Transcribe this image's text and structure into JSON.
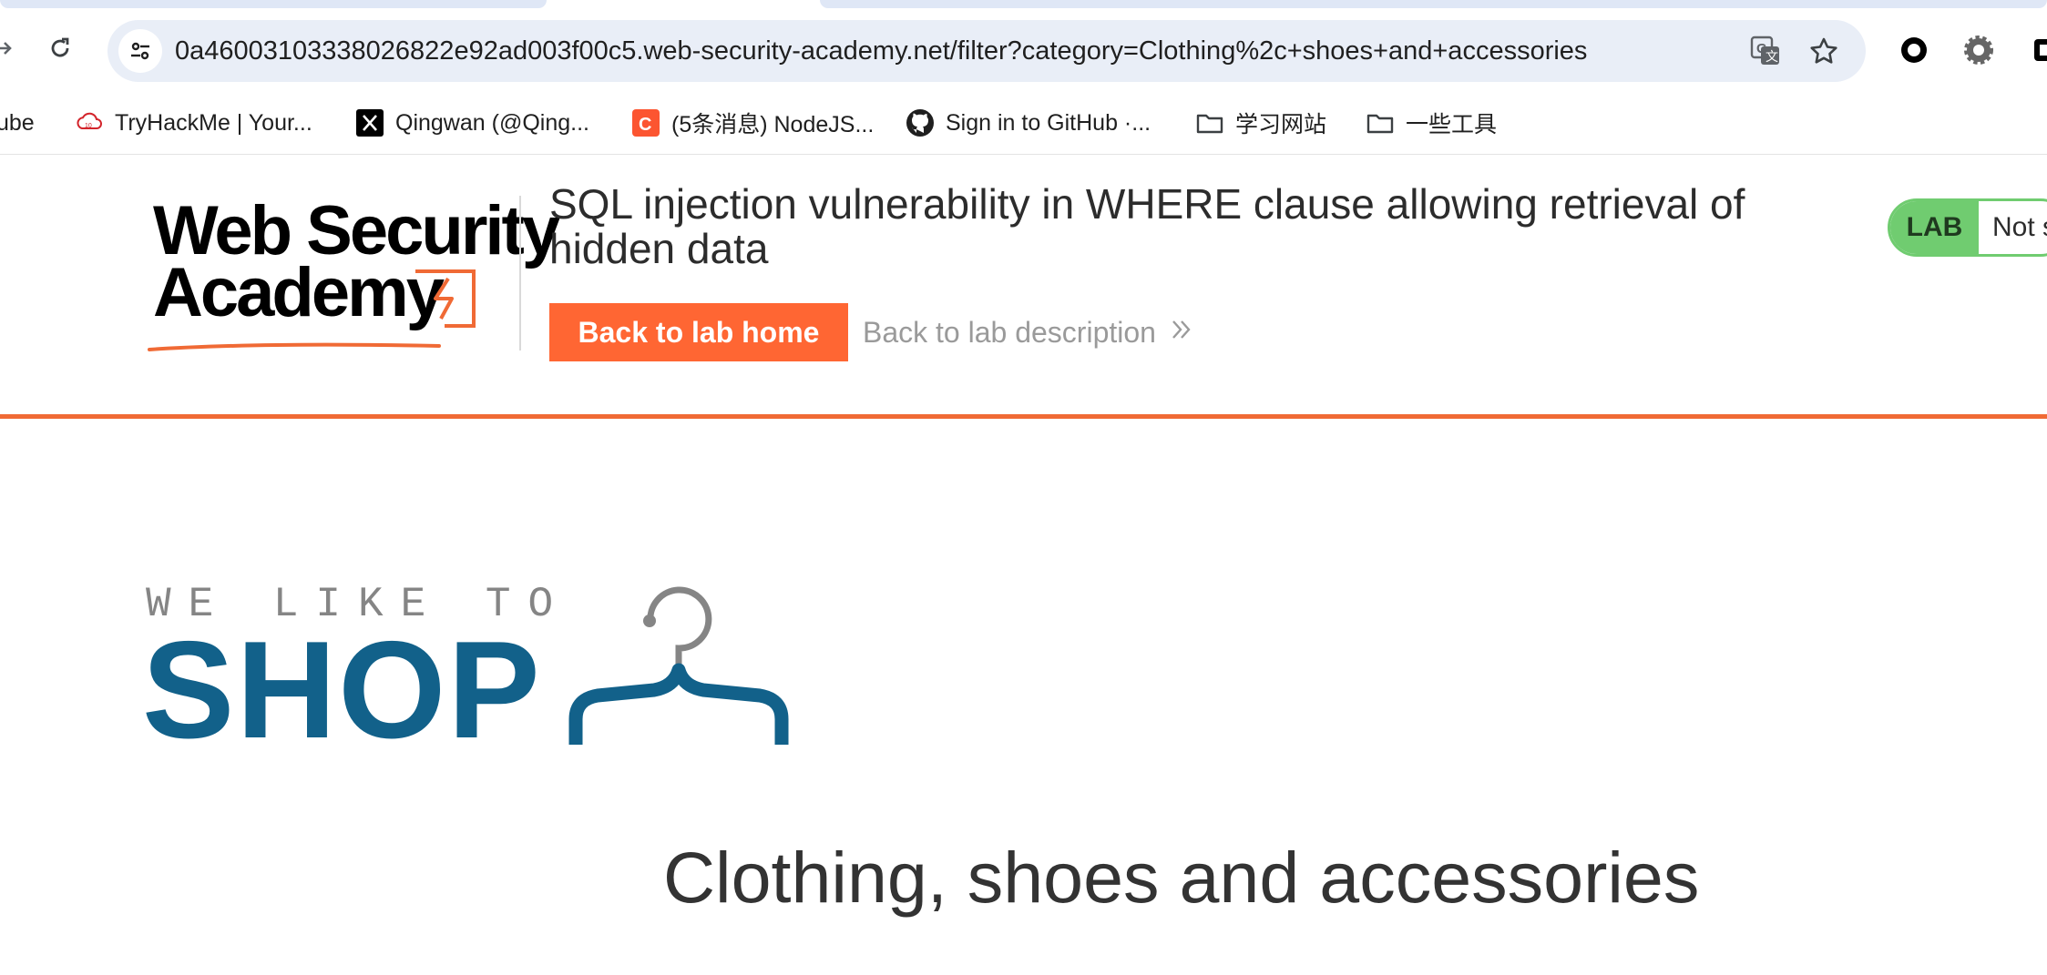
{
  "browser": {
    "url": "0a46003103338026822e92ad003f00c5.web-security-academy.net/filter?category=Clothing%2c+shoes+and+accessories",
    "nav_icons": [
      "forward-icon",
      "reload-icon"
    ],
    "omnibox_icons": [
      "site-info-icon",
      "translate-icon",
      "bookmark-star-icon"
    ],
    "extension_icons": [
      "circle-extension-icon",
      "gear-extension-icon"
    ]
  },
  "bookmarks": [
    {
      "label": "ube",
      "icon": "youtube-icon"
    },
    {
      "label": "TryHackMe | Your...",
      "icon": "tryhackme-icon"
    },
    {
      "label": "Qingwan (@Qing...",
      "icon": "x-icon"
    },
    {
      "label": "(5条消息) NodeJS...",
      "icon": "csdn-icon"
    },
    {
      "label": "Sign in to GitHub ·...",
      "icon": "github-icon"
    },
    {
      "label": "学习网站",
      "icon": "folder-icon"
    },
    {
      "label": "一些工具",
      "icon": "folder-icon"
    }
  ],
  "academy": {
    "logo_line1": "Web Security",
    "logo_line2": "Academy",
    "lab_title": "SQL injection vulnerability in WHERE clause allowing retrieval of hidden data",
    "back_home_label": "Back to lab home",
    "back_description_label": "Back to lab description",
    "lab_badge_label": "LAB",
    "lab_status": "Not solved",
    "colors": {
      "accent": "#ff6633",
      "lab_green": "#70cc70"
    }
  },
  "shop": {
    "tagline": "WE LIKE TO",
    "title": "SHOP",
    "category_heading": "Clothing, shoes and accessories",
    "colors": {
      "shop_blue": "#12618a",
      "hanger_grey": "#858585"
    }
  }
}
